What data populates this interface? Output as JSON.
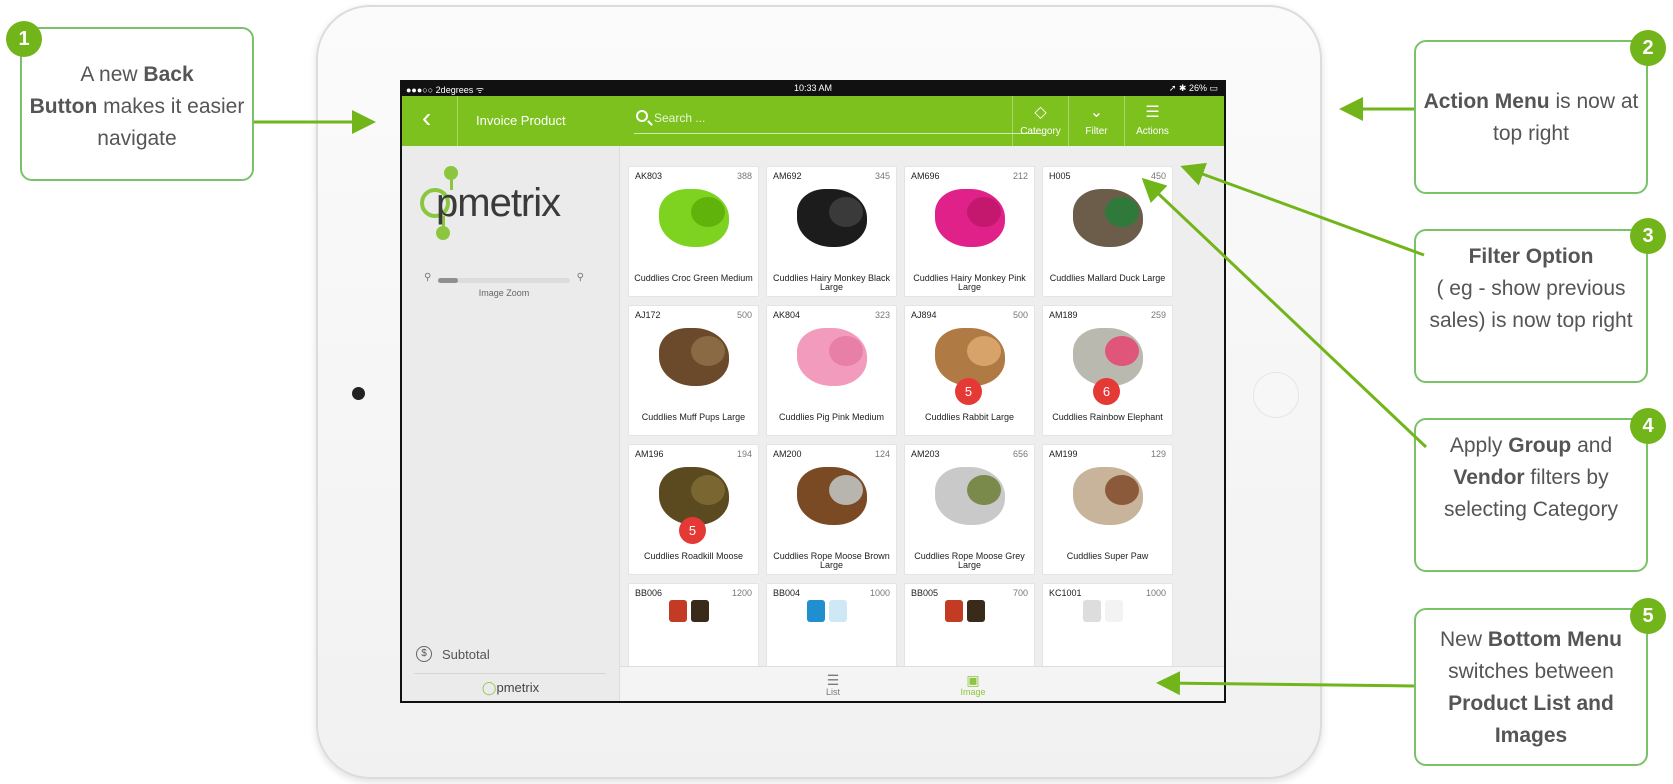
{
  "status_bar": {
    "carrier": "●●●○○ 2degrees ᯤ",
    "time": "10:33 AM",
    "battery": "➚ ✱ 26% ▭"
  },
  "app_bar": {
    "back_icon": "chevron-left-icon",
    "title": "Invoice Product",
    "search_placeholder": "Search ...",
    "actions": [
      {
        "label": "Category",
        "icon": "tag-icon"
      },
      {
        "label": "Filter",
        "icon": "chevron-down-icon"
      },
      {
        "label": "Actions",
        "icon": "menu-icon"
      }
    ]
  },
  "sidebar": {
    "logo_text": "pmetrix",
    "zoom_label": "Image Zoom",
    "zoom_level": 0.15,
    "subtotal_label": "Subtotal",
    "mini_logo_text": "pmetrix"
  },
  "products": [
    {
      "sku": "AK803",
      "qty": "388",
      "name": "Cuddlies Croc Green Medium"
    },
    {
      "sku": "AM692",
      "qty": "345",
      "name": "Cuddlies Hairy Monkey Black Large"
    },
    {
      "sku": "AM696",
      "qty": "212",
      "name": "Cuddlies Hairy Monkey Pink Large"
    },
    {
      "sku": "H005",
      "qty": "450",
      "name": "Cuddlies Mallard Duck Large"
    },
    {
      "sku": "AJ172",
      "qty": "500",
      "name": "Cuddlies Muff Pups Large"
    },
    {
      "sku": "AK804",
      "qty": "323",
      "name": "Cuddlies Pig Pink Medium"
    },
    {
      "sku": "AJ894",
      "qty": "500",
      "name": "Cuddlies Rabbit Large",
      "count": "5"
    },
    {
      "sku": "AM189",
      "qty": "259",
      "name": "Cuddlies Rainbow Elephant",
      "count": "6"
    },
    {
      "sku": "AM196",
      "qty": "194",
      "name": "Cuddlies Roadkill Moose",
      "count": "5"
    },
    {
      "sku": "AM200",
      "qty": "124",
      "name": "Cuddlies Rope Moose Brown Large"
    },
    {
      "sku": "AM203",
      "qty": "656",
      "name": "Cuddlies Rope Moose Grey Large"
    },
    {
      "sku": "AM199",
      "qty": "129",
      "name": "Cuddlies Super Paw"
    },
    {
      "sku": "BB006",
      "qty": "1200",
      "name": ""
    },
    {
      "sku": "BB004",
      "qty": "1000",
      "name": ""
    },
    {
      "sku": "BB005",
      "qty": "700",
      "name": ""
    },
    {
      "sku": "KC1001",
      "qty": "1000",
      "name": ""
    }
  ],
  "bottom_tabs": [
    {
      "label": "List",
      "icon": "list-icon"
    },
    {
      "label": "Image",
      "icon": "image-icon"
    }
  ],
  "callouts": [
    {
      "number": "1",
      "parts": [
        "A new ",
        "Back",
        " ",
        "Button",
        " makes it easier navigate"
      ]
    },
    {
      "number": "2",
      "parts": [
        "Action Menu",
        " is now at top right"
      ]
    },
    {
      "number": "3",
      "parts": [
        "Filter Option",
        "( eg - show previous sales) is now top right"
      ]
    },
    {
      "number": "4",
      "parts": [
        "Apply ",
        "Group",
        " and ",
        "Vendor",
        " filters by selecting Category"
      ]
    },
    {
      "number": "5",
      "parts": [
        "New ",
        "Bottom",
        " ",
        "Menu",
        " switches between ",
        "Product List and Images"
      ]
    }
  ],
  "colors": {
    "accent": "#7dc11f",
    "callout_border": "#79c26a",
    "badge": "#72b51b",
    "count_badge": "#e53935"
  }
}
